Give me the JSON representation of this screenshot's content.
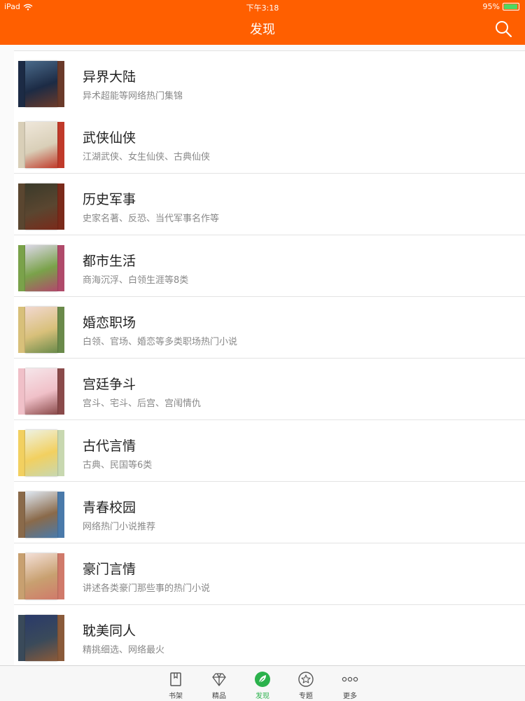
{
  "status_bar": {
    "device": "iPad",
    "time": "下午3:18",
    "battery": "95%",
    "battery_level": 0.95
  },
  "header": {
    "title": "发现"
  },
  "categories": [
    {
      "name": "异界大陆",
      "desc": "异术超能等网络热门集锦",
      "colors": [
        "#1c2b45",
        "#6a3a2a",
        "#4a6a8a"
      ]
    },
    {
      "name": "武侠仙侠",
      "desc": "江湖武侠、女生仙侠、古典仙侠",
      "colors": [
        "#d9cfb8",
        "#c03a2a",
        "#efe7da"
      ]
    },
    {
      "name": "历史军事",
      "desc": "史家名著、反恐、当代军事名作等",
      "colors": [
        "#5a4630",
        "#7a2a1a",
        "#3a3a2a"
      ]
    },
    {
      "name": "都市生活",
      "desc": "商海沉浮、白领生涯等8类",
      "colors": [
        "#7aa24a",
        "#b04a6a",
        "#dcd8e8"
      ]
    },
    {
      "name": "婚恋职场",
      "desc": "白领、官场、婚恋等多类职场热门小说",
      "colors": [
        "#d8c07a",
        "#6a8a4a",
        "#f2d8d0"
      ]
    },
    {
      "name": "宫廷争斗",
      "desc": "宫斗、宅斗、后宫、宫闱情仇",
      "colors": [
        "#f0c0c8",
        "#8a4a4a",
        "#f6e6ea"
      ]
    },
    {
      "name": "古代言情",
      "desc": "古典、民国等6类",
      "colors": [
        "#f2d060",
        "#c8d8b0",
        "#eef2e2"
      ]
    },
    {
      "name": "青春校园",
      "desc": "网络热门小说推荐",
      "colors": [
        "#8a6a4a",
        "#4a7aaa",
        "#dfe8f2"
      ]
    },
    {
      "name": "豪门言情",
      "desc": "讲述各类豪门那些事的热门小说",
      "colors": [
        "#c8a070",
        "#d07a6a",
        "#f4e0d8"
      ]
    },
    {
      "name": "耽美同人",
      "desc": "精挑细选、网络最火",
      "colors": [
        "#3a4a5a",
        "#8a5a3a",
        "#2a3a6a"
      ]
    }
  ],
  "tabbar": [
    {
      "label": "书架",
      "icon": "bookshelf-icon",
      "active": false
    },
    {
      "label": "精品",
      "icon": "diamond-icon",
      "active": false
    },
    {
      "label": "发现",
      "icon": "leaf-icon",
      "active": true
    },
    {
      "label": "专题",
      "icon": "star-badge-icon",
      "active": false
    },
    {
      "label": "更多",
      "icon": "more-dots-icon",
      "active": false
    }
  ],
  "colors": {
    "accent": "#ff5f00",
    "active_tab": "#2bb24c"
  }
}
